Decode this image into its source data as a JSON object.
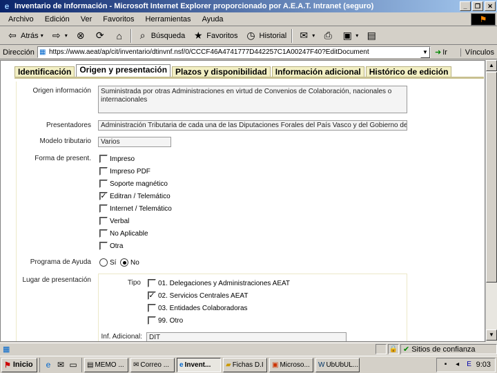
{
  "window": {
    "title": "Inventario de Información - Microsoft Internet Explorer proporcionado por A.E.A.T. Intranet (seguro)"
  },
  "menu": [
    "Archivo",
    "Edición",
    "Ver",
    "Favoritos",
    "Herramientas",
    "Ayuda"
  ],
  "toolbar": {
    "back": "Atrás",
    "search": "Búsqueda",
    "favorites": "Favoritos",
    "history": "Historial"
  },
  "address": {
    "label": "Dirección",
    "url": "https://www.aeat/ap/cit/inventario/dtinvnf.nsf/0/CCCF46A4741777D442257C1A00247F40?EditDocument",
    "go": "Ir",
    "links": "Vínculos"
  },
  "tabs": [
    {
      "label": "Identificación"
    },
    {
      "label": "Origen y presentación"
    },
    {
      "label": "Plazos y disponibilidad"
    },
    {
      "label": "Información adicional"
    },
    {
      "label": "Histórico de edición"
    }
  ],
  "form": {
    "origen_label": "Origen información",
    "origen_value": "Suministrada por otras Administraciones en virtud de Convenios de Colaboración, nacionales o internacionales",
    "presentadores_label": "Presentadores",
    "presentadores_value": "Administración Tributaria de cada una de las Diputaciones Forales del País Vasco y del Gobierno de Navarra",
    "modelo_label": "Modelo tributario",
    "modelo_value": "Varios",
    "forma_label": "Forma de present.",
    "forma_options": [
      {
        "label": "Impreso",
        "checked": false
      },
      {
        "label": "Impreso PDF",
        "checked": false
      },
      {
        "label": "Soporte magnético",
        "checked": false
      },
      {
        "label": "Editran / Telemático",
        "checked": true
      },
      {
        "label": "Internet / Telemático",
        "checked": false
      },
      {
        "label": "Verbal",
        "checked": false
      },
      {
        "label": "No Aplicable",
        "checked": false
      },
      {
        "label": "Otra",
        "checked": false
      }
    ],
    "ayuda_label": "Programa de Ayuda",
    "ayuda_si": "Sí",
    "ayuda_no": "No",
    "ayuda_selected": "No",
    "lugar_label": "Lugar de presentación",
    "tipo_label": "Tipo",
    "lugar_options": [
      {
        "label": "01. Delegaciones y Administraciones AEAT",
        "checked": false
      },
      {
        "label": "02. Servicios Centrales AEAT",
        "checked": true
      },
      {
        "label": "03. Entidades Colaboradoras",
        "checked": false
      },
      {
        "label": "99. Otro",
        "checked": false
      }
    ],
    "inf_label": "Inf. Adicional:",
    "inf_value": "DIT"
  },
  "status": {
    "zone": "Sitios de confianza"
  },
  "taskbar": {
    "start": "Inicio",
    "tasks": [
      "MEMO ...",
      "Correo ...",
      "Invent...",
      "Fichas D.I",
      "Microso...",
      "UbUbUL..."
    ],
    "clock": "9:03"
  }
}
